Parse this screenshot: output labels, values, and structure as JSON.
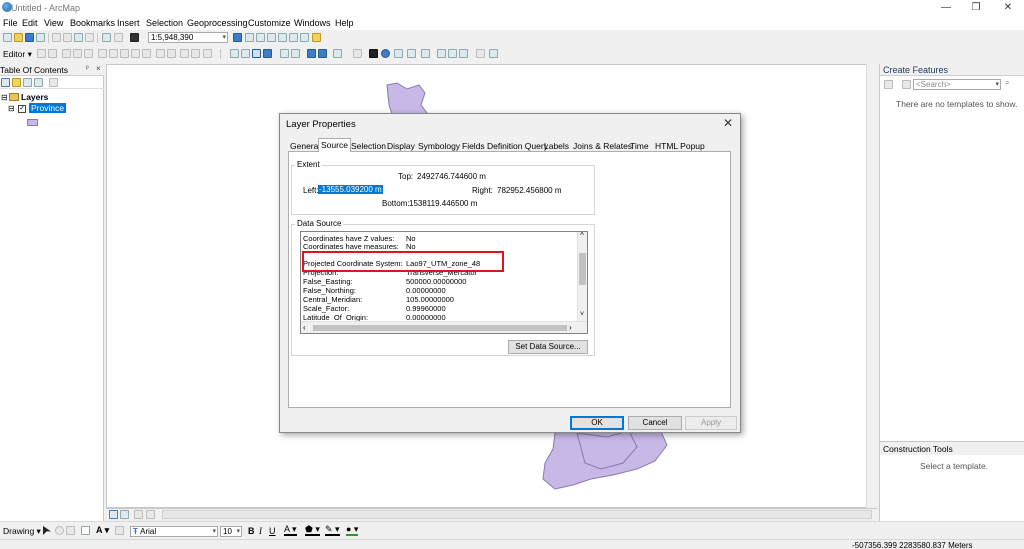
{
  "window": {
    "title": "Untitled - ArcMap",
    "controls": [
      "—",
      "❐",
      "✕"
    ]
  },
  "menu": [
    "File",
    "Edit",
    "View",
    "Bookmarks",
    "Insert",
    "Selection",
    "Geoprocessing",
    "Customize",
    "Windows",
    "Help"
  ],
  "toolbar": {
    "scale_value": "1:5,948,390",
    "editor_label": "Editor ▾"
  },
  "toc": {
    "title": "Table Of Contents",
    "layers_label": "Layers",
    "layer_name": "Province"
  },
  "create_features": {
    "title": "Create Features",
    "search_placeholder": "<Search>",
    "empty_message": "There are no templates to show."
  },
  "construction_tools": {
    "title": "Construction Tools",
    "message": "Select a template."
  },
  "drawing": {
    "label": "Drawing ▾",
    "font_name": "Arial",
    "font_size": "10",
    "bold": "B",
    "italic": "I",
    "underline": "U"
  },
  "status": {
    "coordinates": "-507356.399  2283580.837 Meters"
  },
  "dialog": {
    "title": "Layer Properties",
    "tabs": [
      "General",
      "Source",
      "Selection",
      "Display",
      "Symbology",
      "Fields",
      "Definition Query",
      "Labels",
      "Joins & Relates",
      "Time",
      "HTML Popup"
    ],
    "active_tab": "Source",
    "extent": {
      "label": "Extent",
      "top_label": "Top:",
      "top_value": "2492746.744600 m",
      "left_label": "Left:",
      "left_value": "-13555.039200 m",
      "right_label": "Right:",
      "right_value": "782952.456800 m",
      "bottom_label": "Bottom:",
      "bottom_value": "1538119.446500 m"
    },
    "data_source": {
      "label": "Data Source",
      "rows": [
        {
          "key": "Coordinates have Z values:",
          "value": "No"
        },
        {
          "key": "Coordinates have measures:",
          "value": "No"
        },
        {
          "key": "",
          "value": ""
        },
        {
          "key": "Projected Coordinate System:",
          "value": "Lao97_UTM_zone_48"
        },
        {
          "key": "Projection:",
          "value": "Transverse_Mercator"
        },
        {
          "key": "False_Easting:",
          "value": "500000.00000000"
        },
        {
          "key": "False_Northing:",
          "value": "0.00000000"
        },
        {
          "key": "Central_Meridian:",
          "value": "105.00000000"
        },
        {
          "key": "Scale_Factor:",
          "value": "0.99960000"
        },
        {
          "key": "Latitude_Of_Origin:",
          "value": "0.00000000"
        }
      ],
      "set_button": "Set Data Source..."
    },
    "buttons": {
      "ok": "OK",
      "cancel": "Cancel",
      "apply": "Apply"
    }
  },
  "colors": {
    "polygon_fill": "#c8b8e8",
    "polygon_stroke": "#8a7aa8",
    "highlight_box": "#e0141e",
    "selection_blue": "#0078d7"
  }
}
